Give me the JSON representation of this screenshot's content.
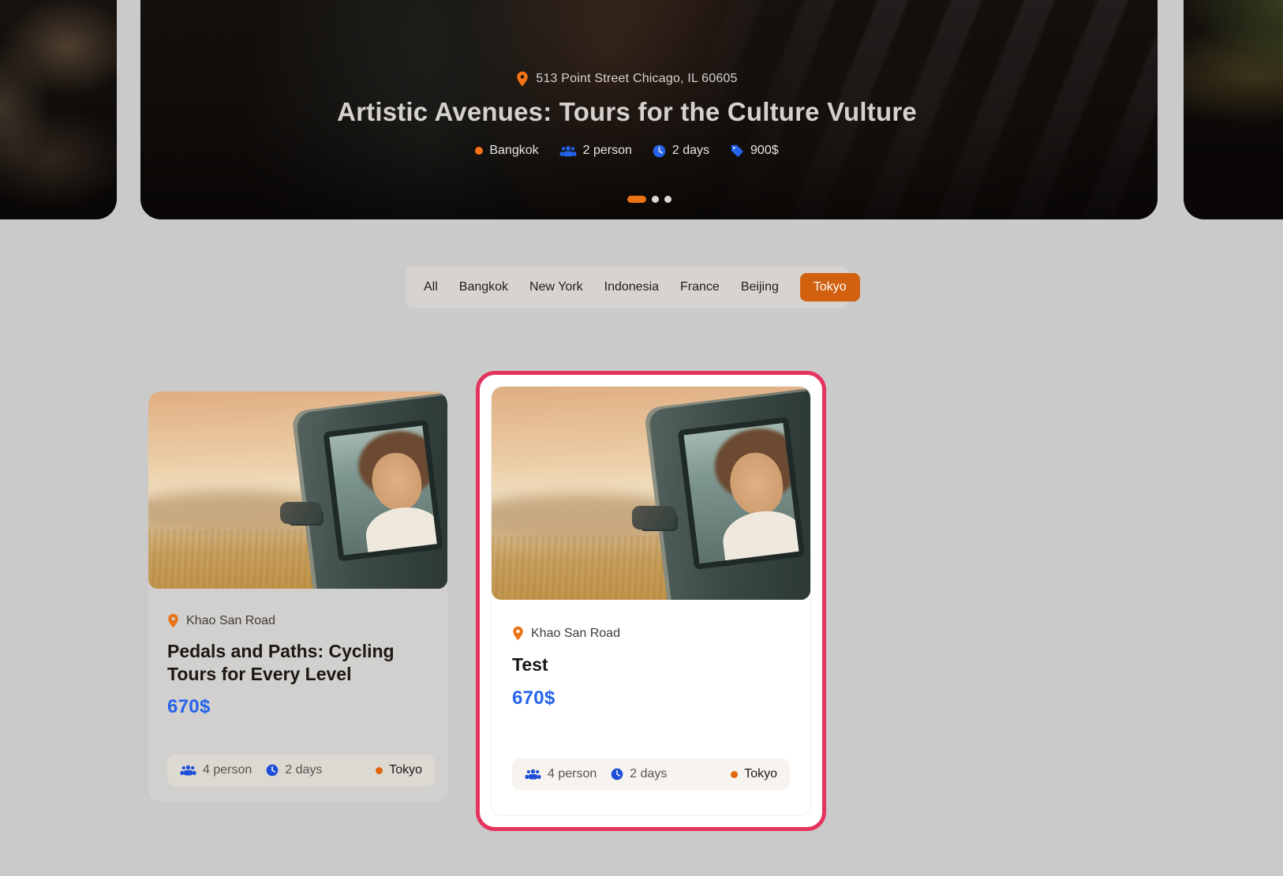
{
  "hero": {
    "address": "513 Point Street Chicago, IL 60605",
    "title": "Artistic Avenues: Tours for the Culture Vulture",
    "meta": {
      "location": "Bangkok",
      "persons": "2 person",
      "duration": "2 days",
      "price": "900$"
    },
    "carousel": {
      "slide_count": 3,
      "active_slide": 1
    }
  },
  "filters": {
    "items": [
      {
        "label": "All",
        "active": false
      },
      {
        "label": "Bangkok",
        "active": false
      },
      {
        "label": "New York",
        "active": false
      },
      {
        "label": "Indonesia",
        "active": false
      },
      {
        "label": "France",
        "active": false
      },
      {
        "label": "Beijing",
        "active": false
      },
      {
        "label": "Tokyo",
        "active": true
      }
    ]
  },
  "cards": [
    {
      "location": "Khao San Road",
      "title": "Pedals and Paths: Cycling Tours for Every Level",
      "price": "670$",
      "persons": "4 person",
      "duration": "2 days",
      "city": "Tokyo",
      "highlighted": false
    },
    {
      "location": "Khao San Road",
      "title": "Test",
      "price": "670$",
      "persons": "4 person",
      "duration": "2 days",
      "city": "Tokyo",
      "highlighted": true
    }
  ],
  "icons": {
    "location_pin": "map-pin",
    "persons": "users-group",
    "duration": "clock",
    "price_tag": "price-tag",
    "city_marker": "orange-dot"
  },
  "colors": {
    "page_background": "#cacaca",
    "accent_orange": "#d2610f",
    "pin_orange": "#f97316",
    "icon_blue": "#2563eb",
    "price_blue": "#2563eb",
    "highlight_pink": "#e5335f"
  }
}
